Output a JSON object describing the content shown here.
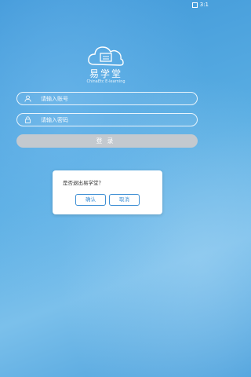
{
  "status_bar": {
    "time": "3:1"
  },
  "brand": {
    "name": "易学堂",
    "subtitle": "ChinaEtc E-learning"
  },
  "login_form": {
    "username_placeholder": "请输入账号",
    "password_placeholder": "请输入密码",
    "login_label": "登录"
  },
  "dialog": {
    "message": "是否退出易学堂？",
    "confirm_label": "确认",
    "cancel_label": "取消"
  },
  "colors": {
    "accent": "#3e8fd4",
    "login_button": "#c3c9cf"
  },
  "icons": [
    "cloud-book-logo-icon",
    "user-icon",
    "lock-icon"
  ]
}
